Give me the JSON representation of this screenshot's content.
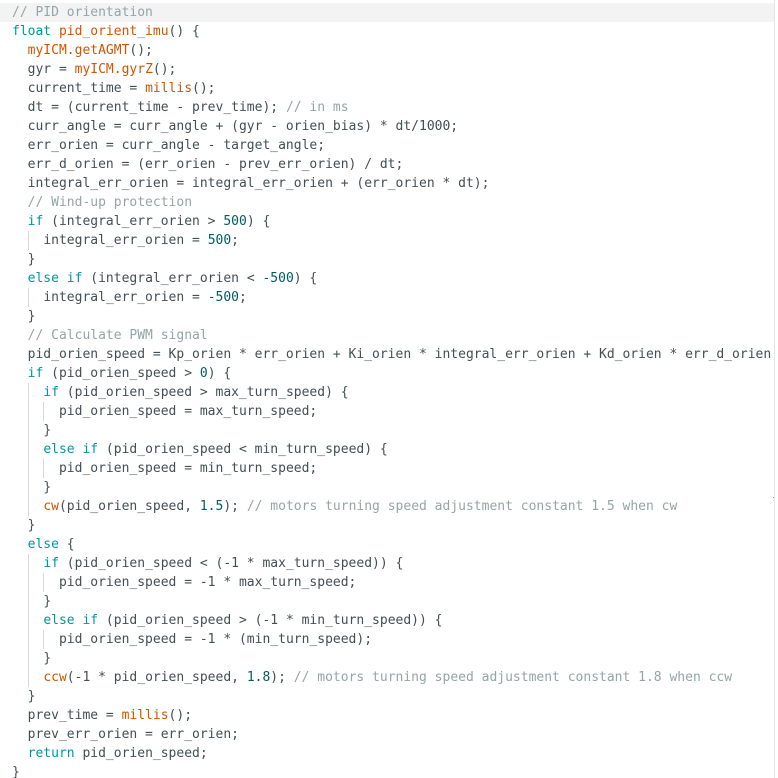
{
  "editor": {
    "lines": [
      {
        "indent": 0,
        "tokens": [
          {
            "t": "comment",
            "v": "// PID orientation"
          }
        ]
      },
      {
        "indent": 0,
        "tokens": [
          {
            "t": "type",
            "v": "float"
          },
          {
            "t": "plain",
            "v": " "
          },
          {
            "t": "func",
            "v": "pid_orient_imu"
          },
          {
            "t": "plain",
            "v": "() {"
          }
        ]
      },
      {
        "indent": 1,
        "tokens": [
          {
            "t": "func",
            "v": "myICM.getAGMT"
          },
          {
            "t": "plain",
            "v": "();"
          }
        ]
      },
      {
        "indent": 1,
        "tokens": [
          {
            "t": "plain",
            "v": "gyr = "
          },
          {
            "t": "func",
            "v": "myICM.gyrZ"
          },
          {
            "t": "plain",
            "v": "();"
          }
        ]
      },
      {
        "indent": 1,
        "tokens": [
          {
            "t": "plain",
            "v": "current_time = "
          },
          {
            "t": "func",
            "v": "millis"
          },
          {
            "t": "plain",
            "v": "();"
          }
        ]
      },
      {
        "indent": 1,
        "tokens": [
          {
            "t": "plain",
            "v": "dt = (current_time - prev_time); "
          },
          {
            "t": "comment",
            "v": "// in ms"
          }
        ]
      },
      {
        "indent": 1,
        "tokens": [
          {
            "t": "plain",
            "v": "curr_angle = curr_angle + (gyr - orien_bias) * dt/1000;"
          }
        ]
      },
      {
        "indent": 1,
        "tokens": [
          {
            "t": "plain",
            "v": "err_orien = curr_angle - target_angle;"
          }
        ]
      },
      {
        "indent": 1,
        "tokens": [
          {
            "t": "plain",
            "v": "err_d_orien = (err_orien - prev_err_orien) / dt;"
          }
        ]
      },
      {
        "indent": 1,
        "tokens": [
          {
            "t": "plain",
            "v": "integral_err_orien = integral_err_orien + (err_orien * dt);"
          }
        ]
      },
      {
        "indent": 1,
        "tokens": [
          {
            "t": "comment",
            "v": "// Wind-up protection"
          }
        ]
      },
      {
        "indent": 1,
        "tokens": [
          {
            "t": "keyword",
            "v": "if"
          },
          {
            "t": "plain",
            "v": " (integral_err_orien > "
          },
          {
            "t": "number",
            "v": "500"
          },
          {
            "t": "plain",
            "v": ") {"
          }
        ]
      },
      {
        "indent": 2,
        "tokens": [
          {
            "t": "plain",
            "v": "integral_err_orien = "
          },
          {
            "t": "number",
            "v": "500"
          },
          {
            "t": "plain",
            "v": ";"
          }
        ]
      },
      {
        "indent": 1,
        "tokens": [
          {
            "t": "plain",
            "v": "}"
          }
        ]
      },
      {
        "indent": 1,
        "tokens": [
          {
            "t": "keyword",
            "v": "else if"
          },
          {
            "t": "plain",
            "v": " (integral_err_orien < "
          },
          {
            "t": "number",
            "v": "-500"
          },
          {
            "t": "plain",
            "v": ") {"
          }
        ]
      },
      {
        "indent": 2,
        "tokens": [
          {
            "t": "plain",
            "v": "integral_err_orien = "
          },
          {
            "t": "number",
            "v": "-500"
          },
          {
            "t": "plain",
            "v": ";"
          }
        ]
      },
      {
        "indent": 1,
        "tokens": [
          {
            "t": "plain",
            "v": "}"
          }
        ]
      },
      {
        "indent": 1,
        "tokens": [
          {
            "t": "comment",
            "v": "// Calculate PWM signal"
          }
        ]
      },
      {
        "indent": 1,
        "tokens": [
          {
            "t": "plain",
            "v": "pid_orien_speed = Kp_orien * err_orien + Ki_orien * integral_err_orien + Kd_orien * err_d_orien;"
          }
        ]
      },
      {
        "indent": 1,
        "tokens": [
          {
            "t": "keyword",
            "v": "if"
          },
          {
            "t": "plain",
            "v": " (pid_orien_speed > "
          },
          {
            "t": "number",
            "v": "0"
          },
          {
            "t": "plain",
            "v": ") {"
          }
        ]
      },
      {
        "indent": 2,
        "tokens": [
          {
            "t": "keyword",
            "v": "if"
          },
          {
            "t": "plain",
            "v": " (pid_orien_speed > max_turn_speed) {"
          }
        ]
      },
      {
        "indent": 3,
        "tokens": [
          {
            "t": "plain",
            "v": "pid_orien_speed = max_turn_speed;"
          }
        ]
      },
      {
        "indent": 2,
        "tokens": [
          {
            "t": "plain",
            "v": "}"
          }
        ]
      },
      {
        "indent": 2,
        "tokens": [
          {
            "t": "keyword",
            "v": "else if"
          },
          {
            "t": "plain",
            "v": " (pid_orien_speed < min_turn_speed) {"
          }
        ]
      },
      {
        "indent": 3,
        "tokens": [
          {
            "t": "plain",
            "v": "pid_orien_speed = min_turn_speed;"
          }
        ]
      },
      {
        "indent": 2,
        "tokens": [
          {
            "t": "plain",
            "v": "}"
          }
        ]
      },
      {
        "indent": 2,
        "tokens": [
          {
            "t": "func",
            "v": "cw"
          },
          {
            "t": "plain",
            "v": "(pid_orien_speed, "
          },
          {
            "t": "number",
            "v": "1.5"
          },
          {
            "t": "plain",
            "v": "); "
          },
          {
            "t": "comment",
            "v": "// motors turning speed adjustment constant 1.5 when cw"
          }
        ]
      },
      {
        "indent": 1,
        "tokens": [
          {
            "t": "plain",
            "v": "}"
          }
        ]
      },
      {
        "indent": 1,
        "tokens": [
          {
            "t": "keyword",
            "v": "else"
          },
          {
            "t": "plain",
            "v": " {"
          }
        ]
      },
      {
        "indent": 2,
        "tokens": [
          {
            "t": "keyword",
            "v": "if"
          },
          {
            "t": "plain",
            "v": " (pid_orien_speed < (-1 * max_turn_speed)) {"
          }
        ]
      },
      {
        "indent": 3,
        "tokens": [
          {
            "t": "plain",
            "v": "pid_orien_speed = -1 * max_turn_speed;"
          }
        ]
      },
      {
        "indent": 2,
        "tokens": [
          {
            "t": "plain",
            "v": "}"
          }
        ]
      },
      {
        "indent": 2,
        "tokens": [
          {
            "t": "keyword",
            "v": "else if"
          },
          {
            "t": "plain",
            "v": " (pid_orien_speed > (-1 * min_turn_speed)) {"
          }
        ]
      },
      {
        "indent": 3,
        "tokens": [
          {
            "t": "plain",
            "v": "pid_orien_speed = -1 * (min_turn_speed);"
          }
        ]
      },
      {
        "indent": 2,
        "tokens": [
          {
            "t": "plain",
            "v": "}"
          }
        ]
      },
      {
        "indent": 2,
        "tokens": [
          {
            "t": "func",
            "v": "ccw"
          },
          {
            "t": "plain",
            "v": "(-1 * pid_orien_speed, "
          },
          {
            "t": "number",
            "v": "1.8"
          },
          {
            "t": "plain",
            "v": "); "
          },
          {
            "t": "comment",
            "v": "// motors turning speed adjustment constant 1.8 when ccw"
          }
        ]
      },
      {
        "indent": 1,
        "tokens": [
          {
            "t": "plain",
            "v": "}"
          }
        ]
      },
      {
        "indent": 1,
        "tokens": [
          {
            "t": "plain",
            "v": "prev_time = "
          },
          {
            "t": "func",
            "v": "millis"
          },
          {
            "t": "plain",
            "v": "();"
          }
        ]
      },
      {
        "indent": 1,
        "tokens": [
          {
            "t": "plain",
            "v": "prev_err_orien = err_orien;"
          }
        ]
      },
      {
        "indent": 1,
        "tokens": [
          {
            "t": "keyword",
            "v": "return"
          },
          {
            "t": "plain",
            "v": " pid_orien_speed;"
          }
        ]
      },
      {
        "indent": 0,
        "tokens": [
          {
            "t": "plain",
            "v": "}"
          }
        ]
      }
    ]
  },
  "colors": {
    "comment": "#95a5a6",
    "keyword": "#00979c",
    "function": "#d35400",
    "number": "#005c5f",
    "text": "#434f54",
    "current_line": "#f3f3f3"
  }
}
